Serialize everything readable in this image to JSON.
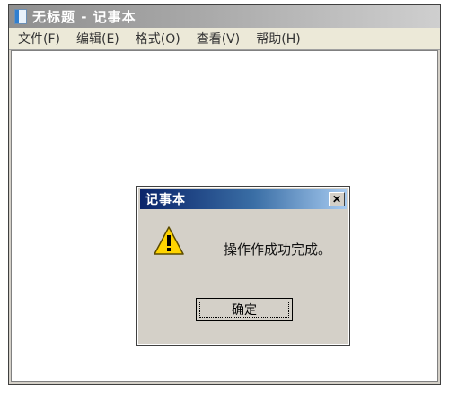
{
  "window": {
    "title": "无标题 - 记事本",
    "icon": "notepad-icon"
  },
  "menubar": {
    "items": [
      {
        "label": "文件(F)"
      },
      {
        "label": "编辑(E)"
      },
      {
        "label": "格式(O)"
      },
      {
        "label": "查看(V)"
      },
      {
        "label": "帮助(H)"
      }
    ]
  },
  "editor": {
    "value": ""
  },
  "dialog": {
    "title": "记事本",
    "close_glyph": "✕",
    "icon": "warning-icon",
    "message": "操作作成功完成。",
    "ok_label": "确定"
  },
  "colors": {
    "dialog_title_start": "#0a246a",
    "dialog_title_end": "#a6caf0",
    "window_face": "#d4d0c8",
    "warning_fill": "#ffd400"
  }
}
